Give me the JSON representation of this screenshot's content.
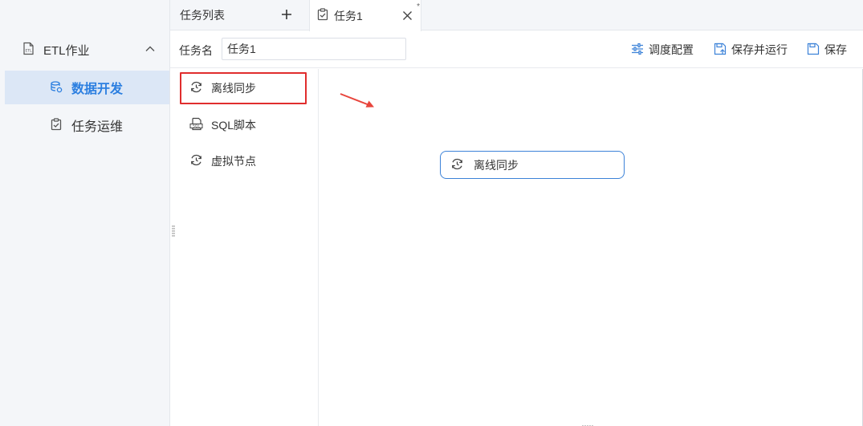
{
  "sidebar": {
    "group": {
      "label": "ETL作业",
      "icon": "etl-file-icon",
      "expanded": true
    },
    "items": [
      {
        "label": "数据开发",
        "icon": "database-icon",
        "active": true
      },
      {
        "label": "任务运维",
        "icon": "clipboard-check-icon",
        "active": false
      }
    ]
  },
  "tabs": {
    "list_label": "任务列表",
    "add_icon": "plus-icon",
    "active_tab": {
      "label": "任务1",
      "icon": "clipboard-check-icon",
      "modified_mark": "*",
      "close_icon": "close-icon"
    }
  },
  "toolbar": {
    "task_name_label": "任务名",
    "task_name_value": "任务1",
    "buttons": [
      {
        "label": "调度配置",
        "icon": "sliders-icon"
      },
      {
        "label": "保存并运行",
        "icon": "save-run-icon"
      },
      {
        "label": "保存",
        "icon": "save-icon"
      }
    ]
  },
  "node_panel": {
    "items": [
      {
        "label": "离线同步",
        "icon": "sync-icon",
        "highlighted": true
      },
      {
        "label": "SQL脚本",
        "icon": "sql-script-icon",
        "highlighted": false
      },
      {
        "label": "虚拟节点",
        "icon": "sync-icon",
        "highlighted": false
      }
    ]
  },
  "canvas": {
    "nodes": [
      {
        "label": "离线同步",
        "icon": "sync-icon"
      }
    ],
    "annotation_icon": "red-arrow-icon"
  },
  "colors": {
    "accent": "#2c7fe0",
    "active_bg": "#dce7f6",
    "highlight_border": "#e02d2d",
    "node_border": "#3c82d8",
    "arrow": "#e8453c"
  }
}
